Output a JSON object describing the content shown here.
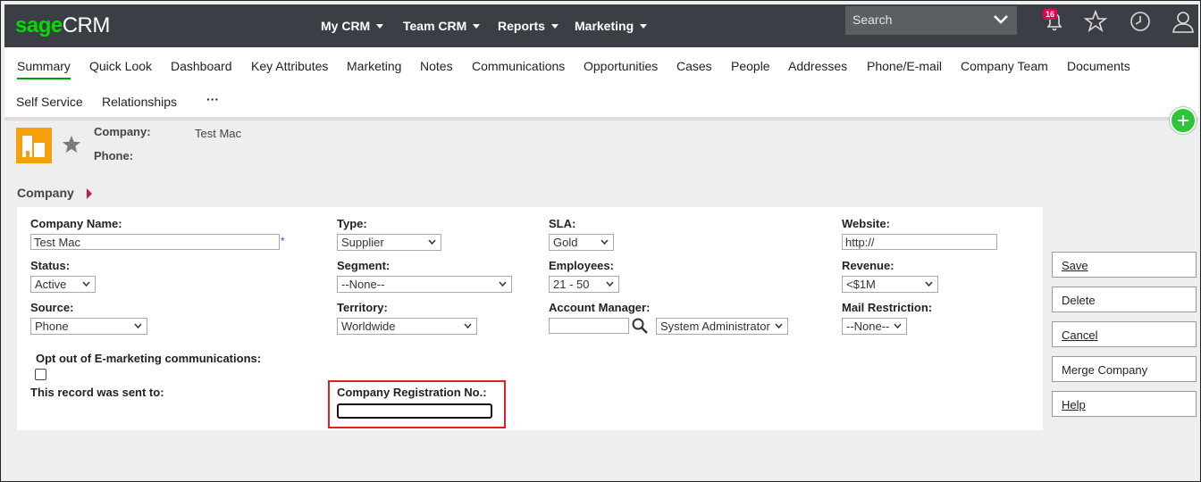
{
  "app": {
    "logo_sage": "sage",
    "logo_crm": "CRM"
  },
  "topnav": [
    {
      "label": "My CRM"
    },
    {
      "label": "Team CRM"
    },
    {
      "label": "Reports"
    },
    {
      "label": "Marketing"
    }
  ],
  "search": {
    "placeholder": "Search"
  },
  "notifications": {
    "count": "16"
  },
  "tabs": [
    {
      "label": "Summary"
    },
    {
      "label": "Quick Look"
    },
    {
      "label": "Dashboard"
    },
    {
      "label": "Key Attributes"
    },
    {
      "label": "Marketing"
    },
    {
      "label": "Notes"
    },
    {
      "label": "Communications"
    },
    {
      "label": "Opportunities"
    },
    {
      "label": "Cases"
    },
    {
      "label": "People"
    },
    {
      "label": "Addresses"
    },
    {
      "label": "Phone/E-mail"
    },
    {
      "label": "Company Team"
    },
    {
      "label": "Documents"
    },
    {
      "label": "Self Service"
    },
    {
      "label": "Relationships"
    },
    {
      "label": "···"
    }
  ],
  "header": {
    "company_label": "Company:",
    "company_value": "Test Mac",
    "phone_label": "Phone:"
  },
  "section": {
    "title": "Company"
  },
  "form": {
    "company_name": {
      "label": "Company Name:",
      "value": "Test Mac",
      "required": "*"
    },
    "type": {
      "label": "Type:",
      "value": "Supplier"
    },
    "sla": {
      "label": "SLA:",
      "value": "Gold"
    },
    "website": {
      "label": "Website:",
      "value": "http://"
    },
    "status": {
      "label": "Status:",
      "value": "Active"
    },
    "segment": {
      "label": "Segment:",
      "value": "--None--"
    },
    "employees": {
      "label": "Employees:",
      "value": "21 - 50"
    },
    "revenue": {
      "label": "Revenue:",
      "value": "<$1M"
    },
    "source": {
      "label": "Source:",
      "value": "Phone"
    },
    "territory": {
      "label": "Territory:",
      "value": "Worldwide"
    },
    "account_manager": {
      "label": "Account Manager:",
      "value": "System Administrator"
    },
    "mail_restriction": {
      "label": "Mail Restriction:",
      "value": "--None--"
    },
    "opt_out": {
      "label": "Opt out of E-marketing communications:"
    },
    "sent_to": {
      "label": "This record was sent to:"
    },
    "registration": {
      "label": "Company Registration No.:"
    }
  },
  "actions": [
    {
      "label": "Save"
    },
    {
      "label": "Delete"
    },
    {
      "label": "Cancel"
    },
    {
      "label": "Merge Company"
    },
    {
      "label": "Help"
    }
  ],
  "colors": {
    "topbar": "#3b3f45",
    "brand_green": "#00dc00",
    "accent_green": "#2ec43a",
    "highlight_red": "#e02020",
    "icon_orange": "#f5a00a"
  }
}
